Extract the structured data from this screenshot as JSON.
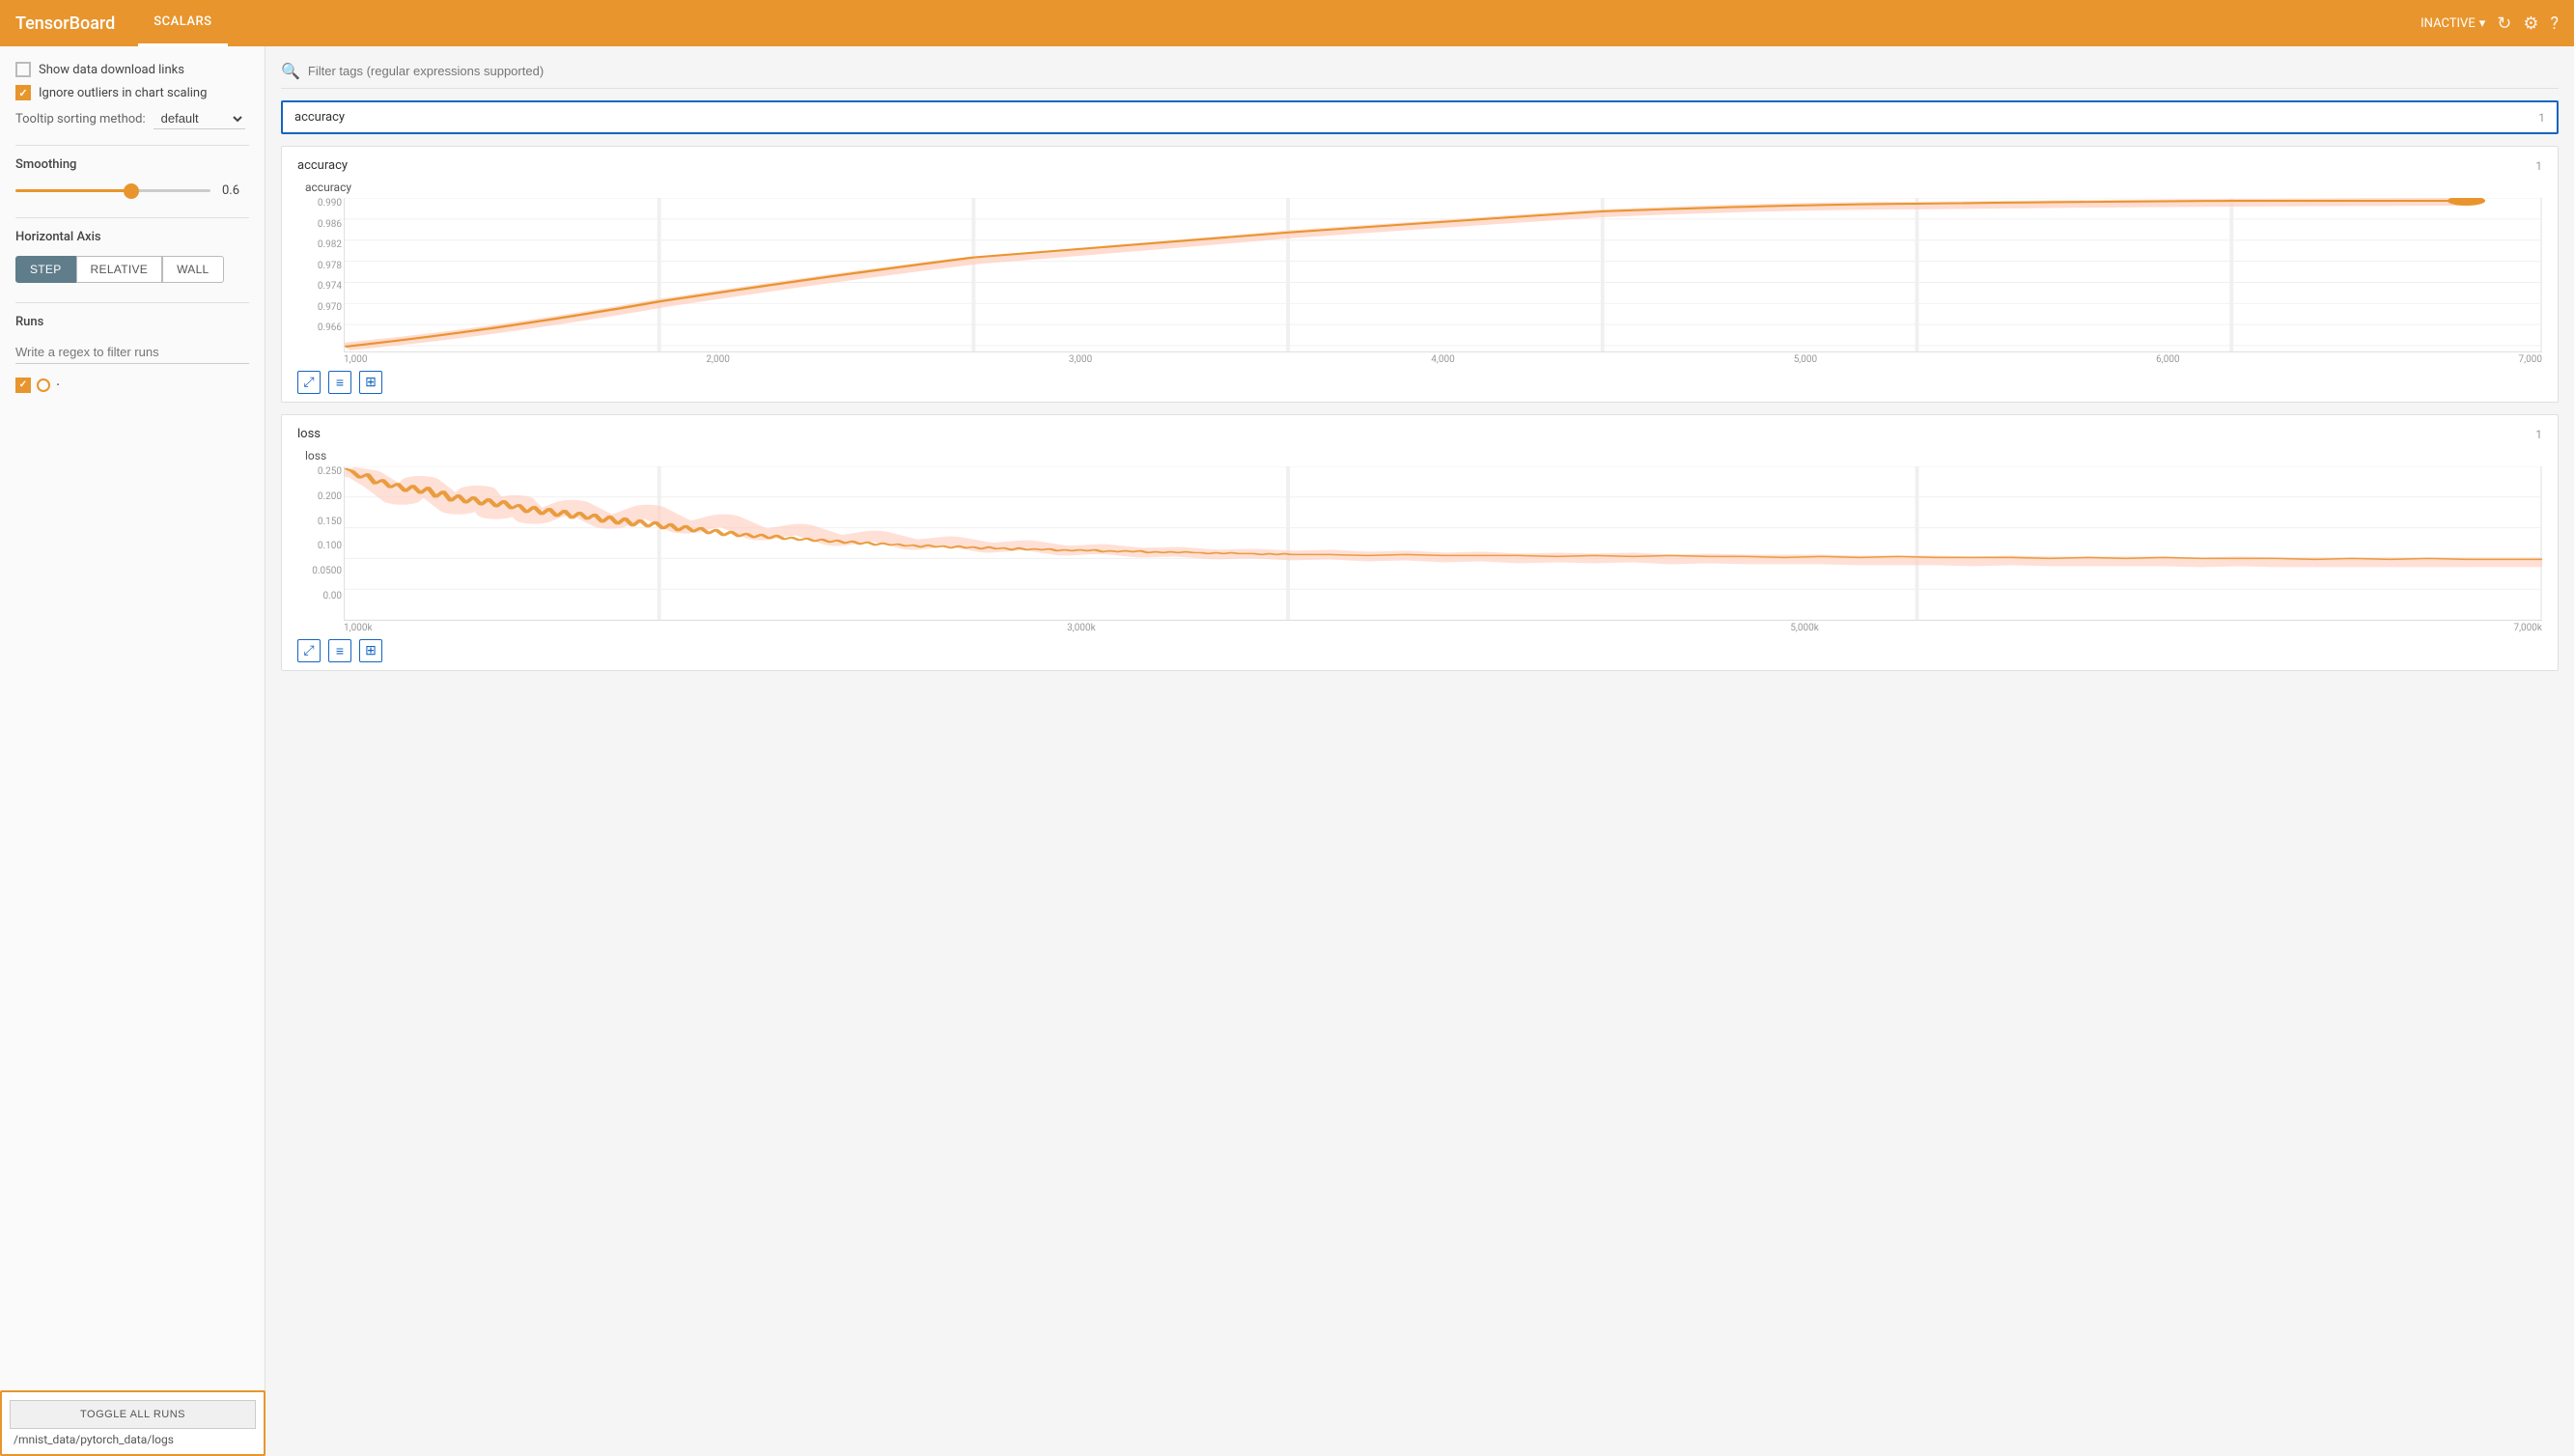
{
  "header": {
    "logo": "TensorBoard",
    "nav_item": "SCALARS",
    "status": "INACTIVE",
    "icons": [
      "refresh",
      "settings",
      "help"
    ]
  },
  "sidebar": {
    "show_download_links_label": "Show data download links",
    "show_download_links_checked": false,
    "ignore_outliers_label": "Ignore outliers in chart scaling",
    "ignore_outliers_checked": true,
    "tooltip_label": "Tooltip sorting method:",
    "tooltip_value": "default",
    "smoothing_label": "Smoothing",
    "smoothing_value": "0.6",
    "horizontal_axis_label": "Horizontal Axis",
    "axis_buttons": [
      "STEP",
      "RELATIVE",
      "WALL"
    ],
    "axis_active": "STEP",
    "runs_label": "Runs",
    "runs_filter_placeholder": "Write a regex to filter runs",
    "toggle_all_label": "TOGGLE ALL RUNS",
    "run_path": "/mnist_data/pytorch_data/logs"
  },
  "filter": {
    "placeholder": "Filter tags (regular expressions supported)"
  },
  "search_box": {
    "value": "accuracy",
    "count": "1"
  },
  "charts": [
    {
      "id": "accuracy",
      "title": "accuracy",
      "inner_title": "accuracy",
      "count": "1",
      "y_labels": [
        "0.990",
        "0.986",
        "0.982",
        "0.978",
        "0.974",
        "0.970",
        "0.966"
      ],
      "x_labels": [
        "1,000",
        "2,000",
        "3,000",
        "4,000",
        "5,000",
        "6,000",
        "7,000"
      ],
      "type": "accuracy"
    },
    {
      "id": "loss",
      "title": "loss",
      "inner_title": "loss",
      "count": "1",
      "y_labels": [
        "0.250",
        "0.200",
        "0.150",
        "0.100",
        "0.0500",
        "0.00"
      ],
      "x_labels": [
        "1,000k",
        "3,000k",
        "5,000k",
        "7,000k"
      ],
      "type": "loss"
    }
  ]
}
